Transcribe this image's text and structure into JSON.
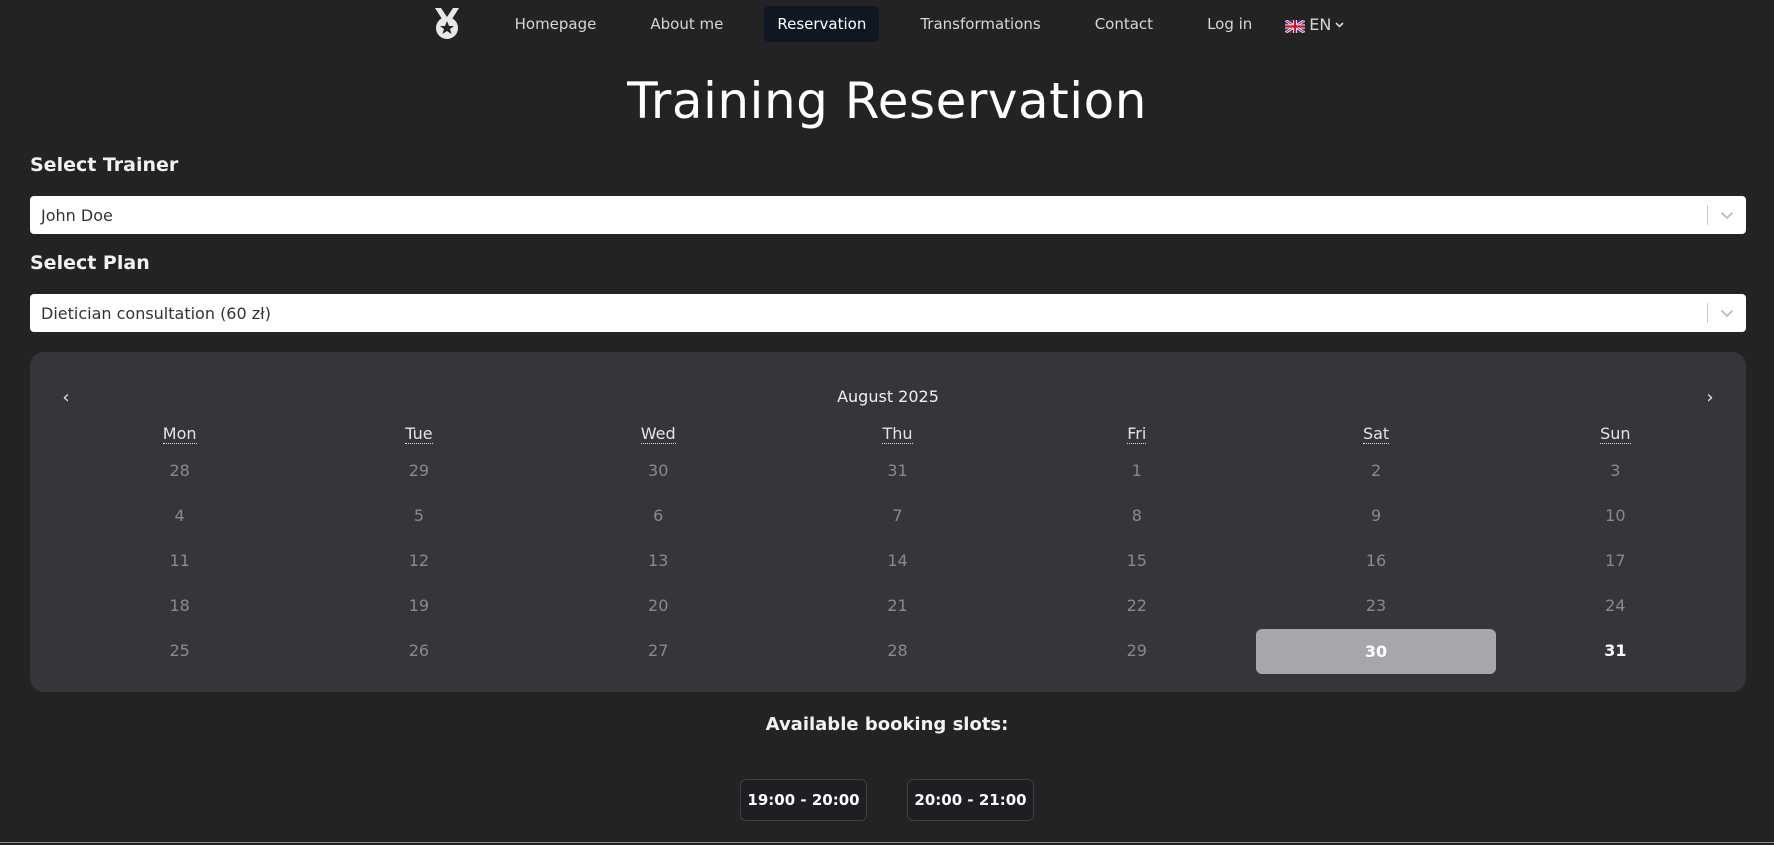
{
  "nav": {
    "items": [
      {
        "label": "Homepage"
      },
      {
        "label": "About me"
      },
      {
        "label": "Reservation",
        "active": true
      },
      {
        "label": "Transformations"
      },
      {
        "label": "Contact"
      },
      {
        "label": "Log in"
      }
    ],
    "language": "EN",
    "logo_icon": "medal-star-icon",
    "flag_icon": "uk-flag-icon"
  },
  "page": {
    "title": "Training Reservation"
  },
  "trainer": {
    "label": "Select Trainer",
    "value": "John Doe"
  },
  "plan": {
    "label": "Select Plan",
    "value": "Dietician consultation (60 zł)"
  },
  "calendar": {
    "month": "August 2025",
    "prev": "‹",
    "next": "›",
    "weekdays": [
      "Mon",
      "Tue",
      "Wed",
      "Thu",
      "Fri",
      "Sat",
      "Sun"
    ],
    "weeks": [
      [
        "28",
        "29",
        "30",
        "31",
        "1",
        "2",
        "3"
      ],
      [
        "4",
        "5",
        "6",
        "7",
        "8",
        "9",
        "10"
      ],
      [
        "11",
        "12",
        "13",
        "14",
        "15",
        "16",
        "17"
      ],
      [
        "18",
        "19",
        "20",
        "21",
        "22",
        "23",
        "24"
      ],
      [
        "25",
        "26",
        "27",
        "28",
        "29",
        "30",
        "31"
      ]
    ],
    "selected_day": "30",
    "enabled_days": [
      "30",
      "31"
    ]
  },
  "slots": {
    "title": "Available booking slots:",
    "items": [
      "19:00 - 20:00",
      "20:00 - 21:00"
    ]
  },
  "colors": {
    "background": "#232323",
    "calendar_bg": "#35353a",
    "selected_day": "#a6a6ad",
    "active_nav": "#0f1624"
  }
}
